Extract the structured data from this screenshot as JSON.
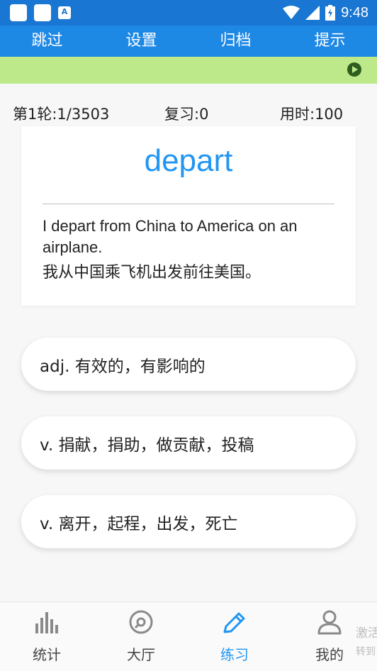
{
  "status_bar": {
    "time": "9:48",
    "icons": [
      "app-icon",
      "app-icon",
      "translate-icon",
      "wifi-icon",
      "signal-icon",
      "battery-icon"
    ]
  },
  "top_nav": {
    "items": [
      {
        "label": "跳过"
      },
      {
        "label": "设置"
      },
      {
        "label": "归档"
      },
      {
        "label": "提示"
      }
    ]
  },
  "banner": {
    "color": "#bde98a",
    "icon": "play-icon"
  },
  "stats": {
    "round": "第1轮:1/3503",
    "review": "复习:0",
    "time_used": "用时:100"
  },
  "word_card": {
    "word": "depart",
    "example_en": "I depart from China to America on an airplane.",
    "example_zh": "我从中国乘飞机出发前往美国。"
  },
  "options": [
    {
      "text": "adj. 有效的，有影响的"
    },
    {
      "text": "v. 捐献，捐助，做贡献，投稿"
    },
    {
      "text": "v. 离开，起程，出发，死亡"
    }
  ],
  "bottom_nav": {
    "tabs": [
      {
        "label": "统计",
        "icon": "bar-chart-icon",
        "active": false
      },
      {
        "label": "大厅",
        "icon": "disc-icon",
        "active": false
      },
      {
        "label": "练习",
        "icon": "pencil-icon",
        "active": true
      },
      {
        "label": "我的",
        "icon": "person-icon",
        "active": false
      }
    ]
  },
  "watermark": {
    "line1": "激活",
    "line2": "转到"
  },
  "colors": {
    "primary": "#1e88e5",
    "status_bar": "#1976d2",
    "accent": "#2196f3"
  }
}
